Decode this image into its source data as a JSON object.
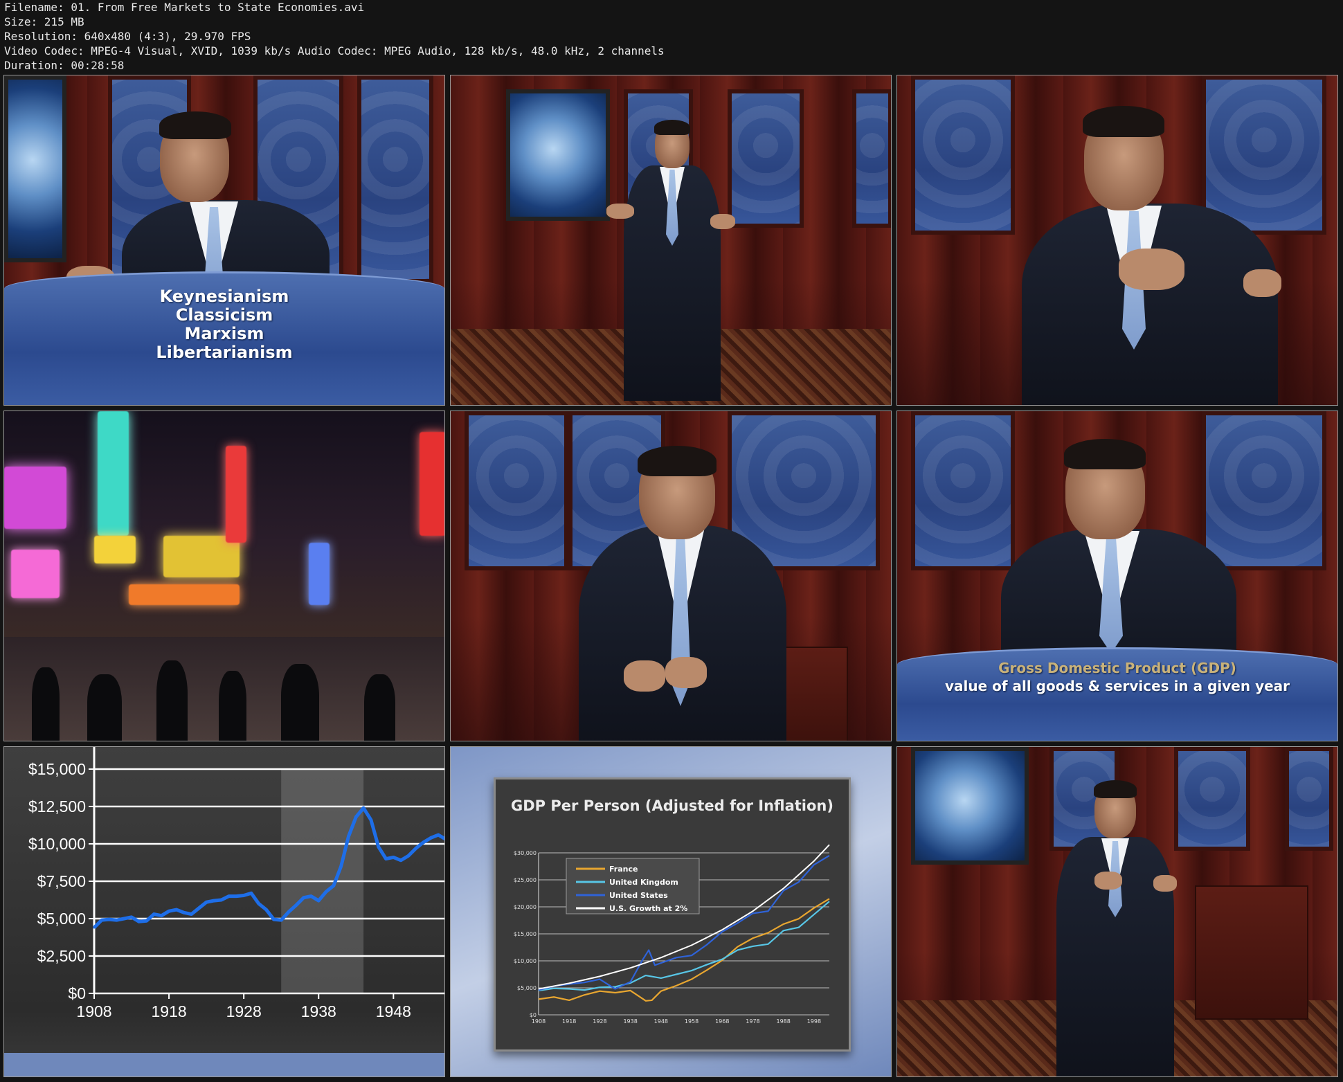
{
  "info": {
    "filename": "Filename: 01. From Free Markets to State Economies.avi",
    "size": "Size: 215 MB",
    "resolution": "Resolution: 640x480 (4:3), 29.970 FPS",
    "codec": "Video Codec: MPEG-4 Visual, XVID, 1039 kb/s Audio Codec: MPEG Audio, 128 kb/s, 48.0 kHz, 2 channels",
    "duration": "Duration: 00:28:58"
  },
  "captions": {
    "tile1": [
      "Keynesianism",
      "Classicism",
      "Marxism",
      "Libertarianism"
    ],
    "tile6_title": "Gross Domestic Product (GDP)",
    "tile6_sub": "value of all goods & services in a given year"
  },
  "colors": {
    "gdp_gold": "#c9b27a",
    "line_blue": "#1e6ee8",
    "france": "#e8a630",
    "uk": "#58c6e6",
    "us": "#2f63d8",
    "trend": "#ffffff"
  },
  "chart_data": [
    {
      "type": "line",
      "yticks": [
        "$15,000",
        "$12,500",
        "$10,000",
        "$7,500",
        "$5,000",
        "$2,500",
        "$0"
      ],
      "ytick_values": [
        15000,
        12500,
        10000,
        7500,
        5000,
        2500,
        0
      ],
      "xticks": [
        "1908",
        "1918",
        "1928",
        "1938",
        "1948"
      ],
      "xtick_values": [
        1908,
        1918,
        1928,
        1938,
        1948
      ],
      "xlim": [
        1908,
        1955
      ],
      "ylim": [
        0,
        15000
      ],
      "series": [
        {
          "x": [
            1908,
            1909,
            1910,
            1911,
            1912,
            1913,
            1914,
            1915,
            1916,
            1917,
            1918,
            1919,
            1920,
            1921,
            1922,
            1923,
            1924,
            1925,
            1926,
            1927,
            1928,
            1929,
            1930,
            1931,
            1932,
            1933,
            1934,
            1935,
            1936,
            1937,
            1938,
            1939,
            1940,
            1941,
            1942,
            1943,
            1944,
            1945,
            1946,
            1947,
            1948,
            1949,
            1950,
            1951,
            1952,
            1953,
            1954,
            1955
          ],
          "values": [
            4400,
            4900,
            4950,
            4900,
            5000,
            5100,
            4800,
            4850,
            5300,
            5200,
            5500,
            5600,
            5400,
            5300,
            5700,
            6100,
            6200,
            6250,
            6500,
            6500,
            6550,
            6700,
            6000,
            5600,
            4950,
            4900,
            5450,
            5900,
            6400,
            6500,
            6200,
            6800,
            7200,
            8500,
            10500,
            11800,
            12400,
            11600,
            9800,
            9000,
            9100,
            8900,
            9200,
            9700,
            10100,
            10400,
            10600,
            10300
          ]
        }
      ],
      "highlight_ranges": [
        [
          1933,
          1944
        ]
      ]
    },
    {
      "type": "line",
      "title": "GDP Per Person (Adjusted for Inflation)",
      "yticks": [
        "$30,000",
        "$25,000",
        "$20,000",
        "$15,000",
        "$10,000",
        "$5,000",
        "$0"
      ],
      "ytick_values": [
        30000,
        25000,
        20000,
        15000,
        10000,
        5000,
        0
      ],
      "xticks": [
        "1908",
        "1918",
        "1928",
        "1938",
        "1948",
        "1958",
        "1968",
        "1978",
        "1988",
        "1998"
      ],
      "xtick_values": [
        1908,
        1918,
        1928,
        1938,
        1948,
        1958,
        1968,
        1978,
        1988,
        1998
      ],
      "xlim": [
        1908,
        2003
      ],
      "ylim": [
        0,
        30000
      ],
      "legend_position": "top-left",
      "series": [
        {
          "name": "France",
          "x": [
            1908,
            1913,
            1918,
            1923,
            1928,
            1933,
            1938,
            1943,
            1945,
            1948,
            1953,
            1958,
            1963,
            1968,
            1973,
            1978,
            1983,
            1988,
            1993,
            1998,
            2003
          ],
          "values": [
            2900,
            3300,
            2700,
            3700,
            4400,
            4100,
            4500,
            2600,
            2700,
            4400,
            5400,
            6600,
            8300,
            10100,
            12600,
            14200,
            15200,
            16800,
            17800,
            19800,
            21500
          ]
        },
        {
          "name": "United Kingdom",
          "x": [
            1908,
            1913,
            1918,
            1923,
            1928,
            1933,
            1938,
            1943,
            1948,
            1953,
            1958,
            1963,
            1968,
            1973,
            1978,
            1983,
            1988,
            1993,
            1998,
            2003
          ],
          "values": [
            4500,
            4900,
            4800,
            4600,
            5100,
            5200,
            5900,
            7300,
            6800,
            7500,
            8200,
            9300,
            10300,
            12000,
            12700,
            13100,
            15600,
            16200,
            18600,
            21000
          ]
        },
        {
          "name": "United States",
          "x": [
            1908,
            1913,
            1918,
            1923,
            1928,
            1933,
            1938,
            1942,
            1944,
            1946,
            1948,
            1953,
            1958,
            1963,
            1968,
            1973,
            1978,
            1983,
            1988,
            1993,
            1998,
            2003
          ],
          "values": [
            4600,
            5300,
            5700,
            6000,
            6600,
            4800,
            6100,
            10200,
            12000,
            9200,
            9600,
            10600,
            11000,
            13000,
            15400,
            17000,
            18800,
            19200,
            23000,
            24600,
            27800,
            29500
          ]
        },
        {
          "name": "U.S. Growth at 2%",
          "x": [
            1908,
            1918,
            1928,
            1938,
            1948,
            1958,
            1968,
            1978,
            1988,
            1998,
            2003
          ],
          "values": [
            4800,
            5850,
            7130,
            8690,
            10600,
            12900,
            15750,
            19200,
            23400,
            28500,
            31500
          ]
        }
      ]
    }
  ]
}
